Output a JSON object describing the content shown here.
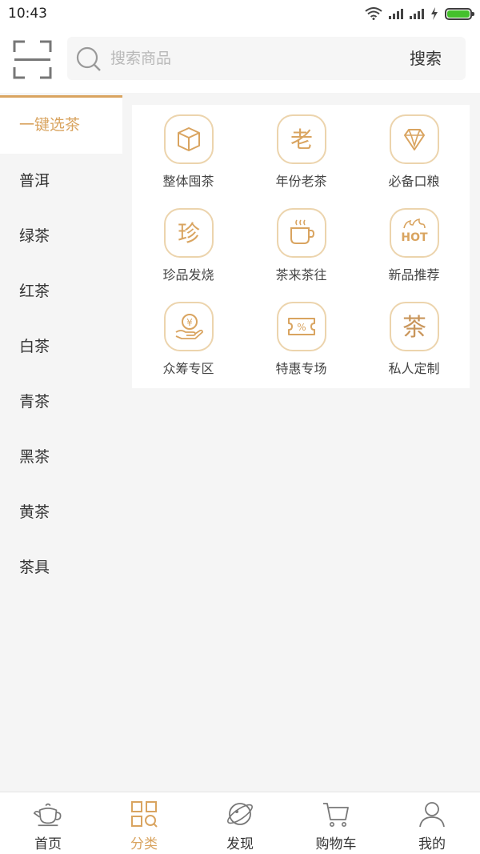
{
  "status_bar": {
    "time": "10:43"
  },
  "header": {
    "search_placeholder": "搜索商品",
    "search_button": "搜索"
  },
  "sidebar": {
    "items": [
      {
        "label": "一键选茶",
        "active": true
      },
      {
        "label": "普洱"
      },
      {
        "label": "绿茶"
      },
      {
        "label": "红茶"
      },
      {
        "label": "白茶"
      },
      {
        "label": "青茶"
      },
      {
        "label": "黑茶"
      },
      {
        "label": "黄茶"
      },
      {
        "label": "茶具"
      }
    ]
  },
  "grid": {
    "items": [
      {
        "label": "整体囤茶",
        "icon": "box-icon"
      },
      {
        "label": "年份老茶",
        "icon": "old-character-icon"
      },
      {
        "label": "必备口粮",
        "icon": "diamond-icon"
      },
      {
        "label": "珍品发烧",
        "icon": "treasure-character-icon"
      },
      {
        "label": "茶来茶往",
        "icon": "tea-cup-icon"
      },
      {
        "label": "新品推荐",
        "icon": "hot-icon"
      },
      {
        "label": "众筹专区",
        "icon": "hand-coin-icon"
      },
      {
        "label": "特惠专场",
        "icon": "coupon-icon"
      },
      {
        "label": "私人定制",
        "icon": "tea-character-icon"
      }
    ],
    "icon_texts": {
      "old": "老",
      "treasure": "珍",
      "hot": "HOT",
      "tea": "茶",
      "yen": "¥",
      "percent": "%"
    }
  },
  "tabbar": {
    "items": [
      {
        "label": "首页",
        "icon": "teapot-icon"
      },
      {
        "label": "分类",
        "icon": "category-icon",
        "active": true
      },
      {
        "label": "发现",
        "icon": "planet-icon"
      },
      {
        "label": "购物车",
        "icon": "cart-icon"
      },
      {
        "label": "我的",
        "icon": "person-icon"
      }
    ]
  },
  "colors": {
    "accent": "#d9a460",
    "icon_border": "#ecd4ad",
    "battery": "#44c02c"
  }
}
